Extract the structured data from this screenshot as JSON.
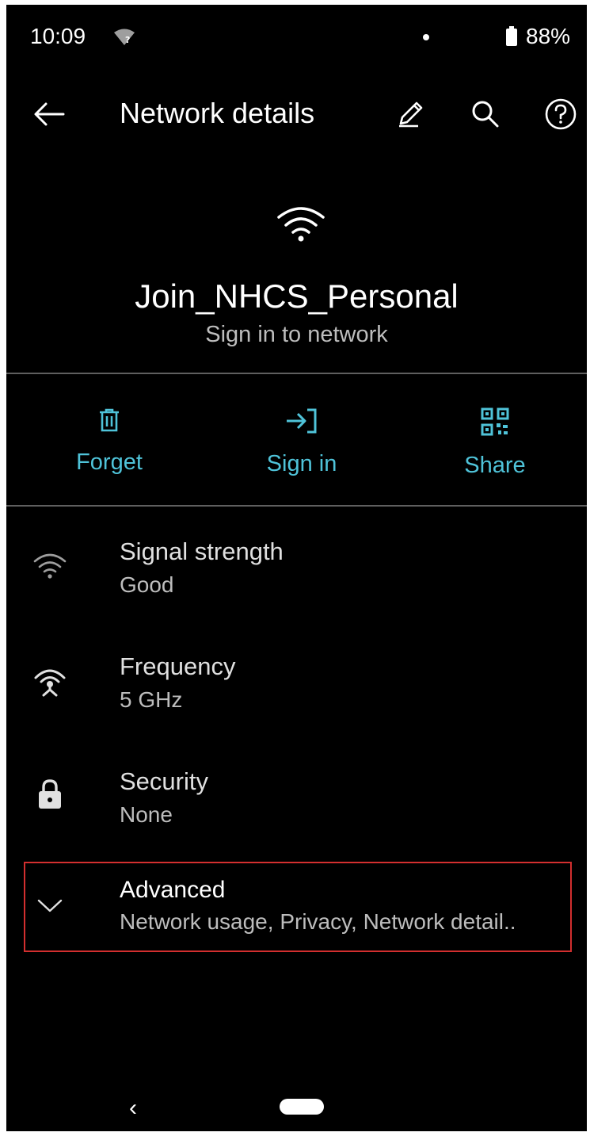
{
  "status_bar": {
    "time": "10:09",
    "battery_percent": "88%",
    "battery_level": 0.88,
    "wifi_icon": "wifi-unknown-icon"
  },
  "app_bar": {
    "title": "Network details",
    "back_icon": "back-arrow-icon",
    "edit_icon": "pencil-icon",
    "search_icon": "search-icon",
    "help_icon": "help-icon"
  },
  "network": {
    "name": "Join_NHCS_Personal",
    "status": "Sign in to network"
  },
  "actions": [
    {
      "label": "Forget",
      "icon": "trash-icon"
    },
    {
      "label": "Sign in",
      "icon": "sign-in-icon"
    },
    {
      "label": "Share",
      "icon": "qr-code-icon"
    }
  ],
  "details": [
    {
      "title": "Signal strength",
      "value": "Good",
      "icon": "wifi-icon"
    },
    {
      "title": "Frequency",
      "value": "5 GHz",
      "icon": "antenna-icon"
    },
    {
      "title": "Security",
      "value": "None",
      "icon": "lock-icon"
    }
  ],
  "advanced": {
    "title": "Advanced",
    "summary": "Network usage, Privacy, Network detail..",
    "icon": "chevron-down-icon"
  },
  "nav_bar": {
    "back_glyph": "‹"
  },
  "colors": {
    "accent": "#4fc3d9",
    "background": "#000000",
    "highlight_border": "#d32f2f"
  }
}
